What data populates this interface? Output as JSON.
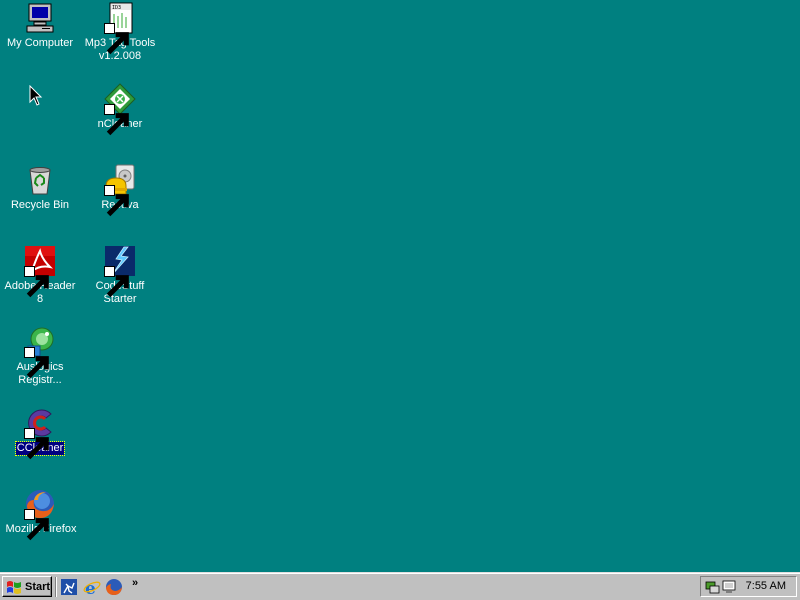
{
  "desktop": {
    "background_color": "#008080",
    "icons": [
      {
        "label": "My Computer",
        "icon": "my-computer-icon",
        "shortcut": false
      },
      {
        "label": "Mp3 Tag Tools v1.2.008",
        "icon": "mp3-tag-tools-icon",
        "shortcut": true
      },
      {
        "label": "nCleaner",
        "icon": "ncleaner-icon",
        "shortcut": true
      },
      {
        "label": "Recycle Bin",
        "icon": "recycle-bin-icon",
        "shortcut": false
      },
      {
        "label": "Recuva",
        "icon": "recuva-icon",
        "shortcut": true
      },
      {
        "label": "Adobe Reader 8",
        "icon": "adobe-reader-icon",
        "shortcut": true
      },
      {
        "label": "CodeStuff Starter",
        "icon": "codestuff-starter-icon",
        "shortcut": true
      },
      {
        "label": "Auslogics Registr...",
        "icon": "auslogics-registry-icon",
        "shortcut": true
      },
      {
        "label": "CCleaner",
        "icon": "ccleaner-icon",
        "shortcut": true,
        "selected": true
      },
      {
        "label": "Mozilla Firefox",
        "icon": "firefox-icon",
        "shortcut": true
      }
    ]
  },
  "taskbar": {
    "start_label": "Start",
    "quick_launch": [
      "show-desktop-icon",
      "internet-explorer-icon",
      "firefox-icon"
    ],
    "quick_launch_more": "»",
    "tray_icons": [
      "network-icon",
      "display-icon"
    ],
    "clock": "7:55 AM"
  }
}
